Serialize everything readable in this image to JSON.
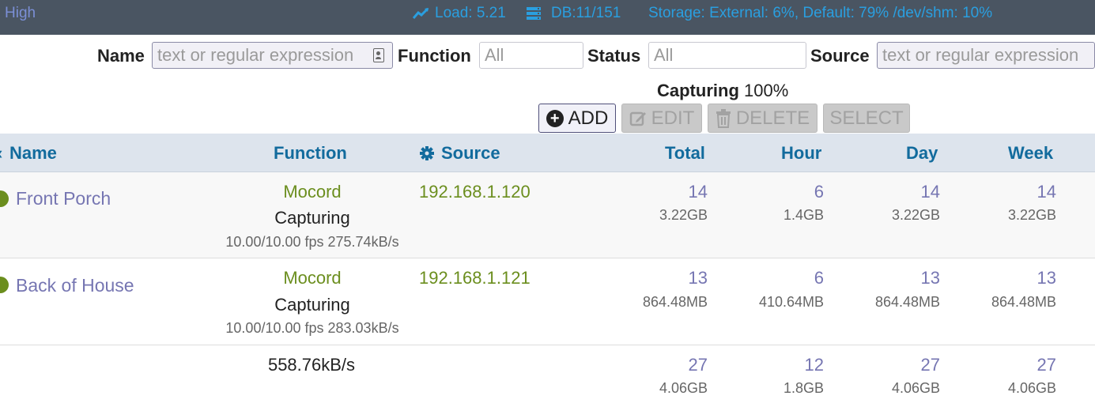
{
  "topbar": {
    "high": "High",
    "load": "Load: 5.21",
    "db": "DB:11/151",
    "storage": "Storage: External: 6%, Default: 79% /dev/shm: 10%"
  },
  "filters": {
    "name_label": "Name",
    "name_placeholder": "text or regular expression",
    "function_label": "Function",
    "function_value": "All",
    "status_label": "Status",
    "status_value": "All",
    "source_label": "Source",
    "source_placeholder": "text or regular expression"
  },
  "capturing": {
    "label": "Capturing",
    "value": "100%"
  },
  "buttons": {
    "add": "ADD",
    "edit": "EDIT",
    "delete": "DELETE",
    "select": "SELECT"
  },
  "columns": {
    "name": "Name",
    "function": "Function",
    "source": "Source",
    "total": "Total",
    "hour": "Hour",
    "day": "Day",
    "week": "Week"
  },
  "monitors": [
    {
      "name": "Front Porch",
      "function": "Mocord",
      "status": "Capturing",
      "fps": "10.00/10.00 fps 275.74kB/s",
      "source": "192.168.1.120",
      "total": "14",
      "total_size": "3.22GB",
      "hour": "6",
      "hour_size": "1.4GB",
      "day": "14",
      "day_size": "3.22GB",
      "week": "14",
      "week_size": "3.22GB"
    },
    {
      "name": "Back of House",
      "function": "Mocord",
      "status": "Capturing",
      "fps": "10.00/10.00 fps 283.03kB/s",
      "source": "192.168.1.121",
      "total": "13",
      "total_size": "864.48MB",
      "hour": "6",
      "hour_size": "410.64MB",
      "day": "13",
      "day_size": "864.48MB",
      "week": "13",
      "week_size": "864.48MB"
    }
  ],
  "totals": {
    "bandwidth": "558.76kB/s",
    "total": "27",
    "total_size": "4.06GB",
    "hour": "12",
    "hour_size": "1.8GB",
    "day": "27",
    "day_size": "4.06GB",
    "week": "27",
    "week_size": "4.06GB"
  },
  "colors": {
    "topbar_bg": "#4a5562",
    "header_link": "#126b9d",
    "status_green": "#6b8e1e",
    "monitor_link": "#7676b2"
  },
  "icons": [
    "line-chart-icon",
    "database-icon",
    "contact-card-icon",
    "plus-circle-icon",
    "edit-icon",
    "trash-icon",
    "gear-icon",
    "status-dot-icon"
  ]
}
